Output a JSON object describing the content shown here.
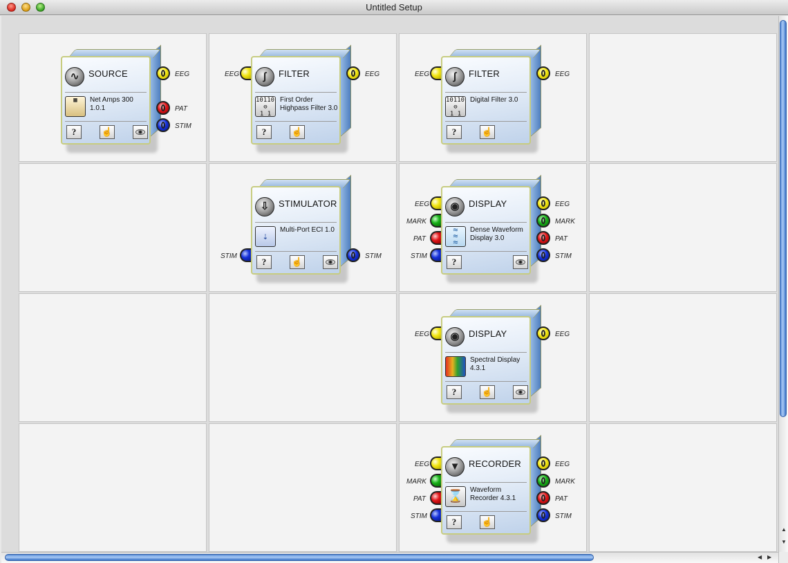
{
  "window": {
    "title": "Untitled Setup"
  },
  "ports": {
    "eeg": "EEG",
    "pat": "PAT",
    "stim": "STIM",
    "mark": "MARK"
  },
  "buttons": {
    "help": "?",
    "hand": "☝"
  },
  "blocks": {
    "source": {
      "title": "SOURCE",
      "icon": "waveform-icon",
      "plugin": [
        "Net Amps 300",
        "1.0.1"
      ]
    },
    "filter1": {
      "title": "FILTER",
      "icon": "filter-curve-icon",
      "plugin": [
        "First Order",
        "Highpass Filter 3.0"
      ],
      "plugin_icon_text": [
        "101101",
        "1 1 01"
      ]
    },
    "filter2": {
      "title": "FILTER",
      "icon": "filter-curve-icon",
      "plugin": [
        "Digital Filter 3.0",
        ""
      ],
      "plugin_icon_text": [
        "101101",
        "1 1 01"
      ]
    },
    "stimulator": {
      "title": "STIMULATOR",
      "icon": "down-arrow-icon",
      "plugin": [
        "Multi-Port ECI 1.0",
        ""
      ]
    },
    "display1": {
      "title": "DISPLAY",
      "icon": "eye-icon",
      "plugin": [
        "Dense Waveform",
        "Display 3.0"
      ]
    },
    "display2": {
      "title": "DISPLAY",
      "icon": "eye-icon",
      "plugin": [
        "Spectral Display",
        "4.3.1"
      ]
    },
    "recorder": {
      "title": "RECORDER",
      "icon": "recorder-icon",
      "plugin": [
        "Waveform",
        "Recorder 4.3.1"
      ]
    }
  },
  "colors": {
    "eeg": "#f2e614",
    "pat": "#e2161a",
    "stim": "#1530d8",
    "mark": "#18b018",
    "scroll": "#5b8fd8"
  }
}
